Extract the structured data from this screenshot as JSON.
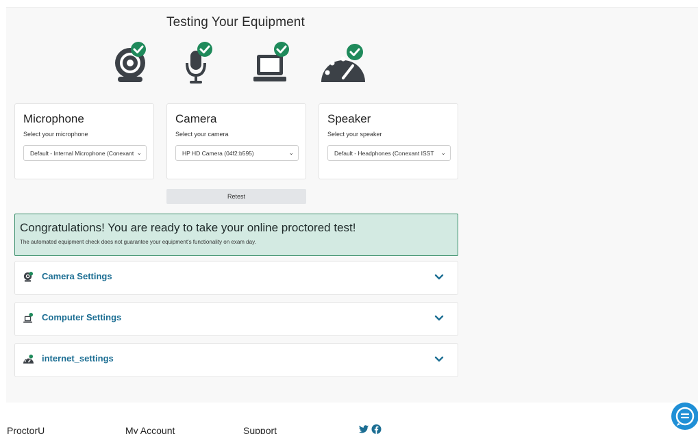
{
  "title": "Testing Your Equipment",
  "equipment_icons": [
    {
      "name": "webcam-icon",
      "status": "check"
    },
    {
      "name": "microphone-icon",
      "status": "check"
    },
    {
      "name": "laptop-icon",
      "status": "check"
    },
    {
      "name": "speedometer-icon",
      "status": "check"
    }
  ],
  "cards": {
    "microphone": {
      "title": "Microphone",
      "subtitle": "Select your microphone",
      "selected": "Default - Internal Microphone (Conexant"
    },
    "camera": {
      "title": "Camera",
      "subtitle": "Select your camera",
      "selected": "HP HD Camera (04f2:b595)"
    },
    "speaker": {
      "title": "Speaker",
      "subtitle": "Select your speaker",
      "selected": "Default - Headphones (Conexant ISST"
    }
  },
  "retest_label": "Retest",
  "congrats": {
    "heading": "Congratulations! You are ready to take your online proctored test!",
    "note": "The automated equipment check does not guarantee your equipment's functionality on exam day."
  },
  "accordion": [
    {
      "label": "Camera Settings",
      "icon": "webcam-icon"
    },
    {
      "label": "Computer Settings",
      "icon": "laptop-icon"
    },
    {
      "label": "internet_settings",
      "icon": "speedometer-icon"
    }
  ],
  "footer": {
    "brand": "ProctorU",
    "account": "My Account",
    "support": "Support"
  },
  "colors": {
    "check_green": "#1f8a5b",
    "icon_dark": "#3c4147",
    "link_blue": "#1c6e93",
    "success_bg": "#d3eae2",
    "chat_blue": "#1f8fd6"
  }
}
